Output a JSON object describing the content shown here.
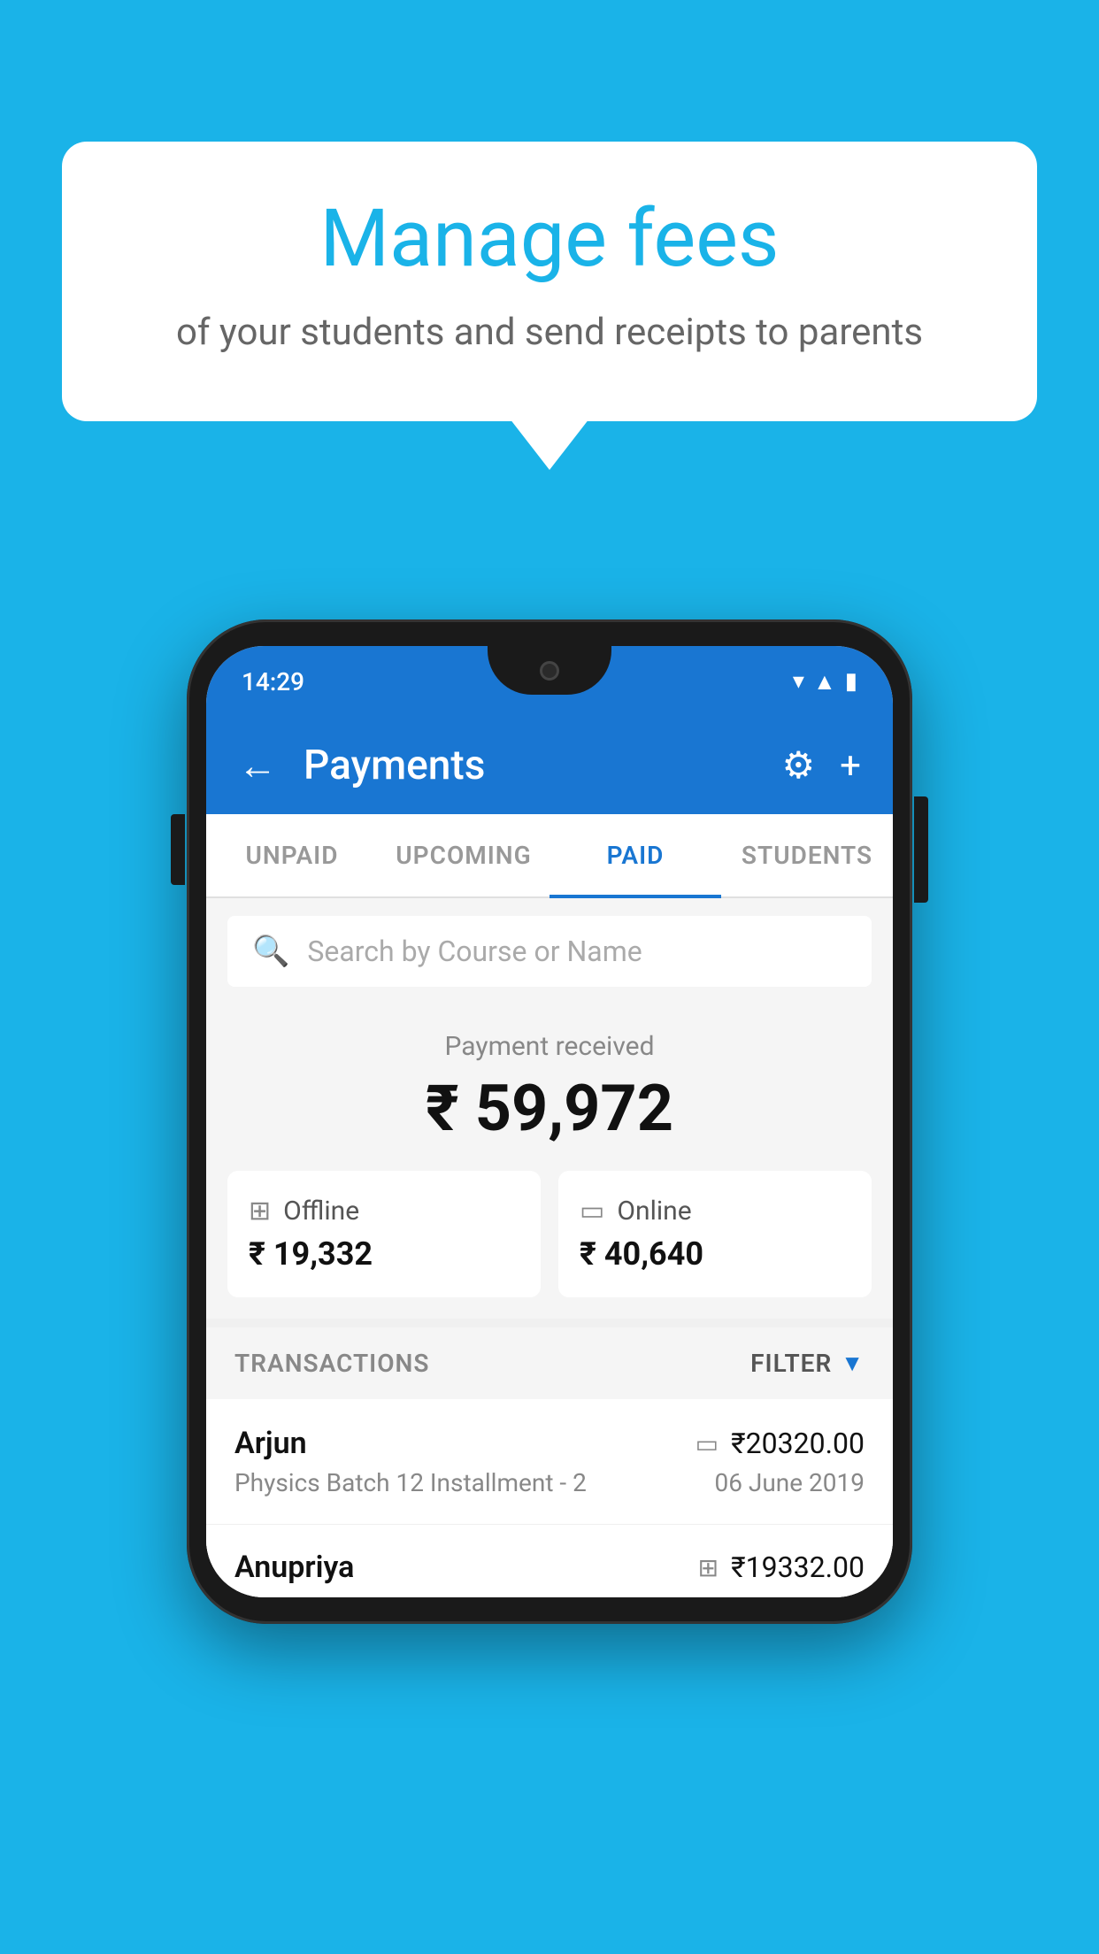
{
  "background_color": "#1ab3e8",
  "bubble": {
    "title": "Manage fees",
    "subtitle": "of your students and send receipts to parents"
  },
  "phone": {
    "status_bar": {
      "time": "14:29"
    },
    "header": {
      "title": "Payments",
      "back_label": "←",
      "settings_label": "⚙",
      "add_label": "+"
    },
    "tabs": [
      {
        "label": "UNPAID",
        "active": false
      },
      {
        "label": "UPCOMING",
        "active": false
      },
      {
        "label": "PAID",
        "active": true
      },
      {
        "label": "STUDENTS",
        "active": false
      }
    ],
    "search": {
      "placeholder": "Search by Course or Name"
    },
    "payment_summary": {
      "label": "Payment received",
      "total": "₹ 59,972",
      "offline_label": "Offline",
      "offline_amount": "₹ 19,332",
      "online_label": "Online",
      "online_amount": "₹ 40,640"
    },
    "transactions": {
      "section_label": "TRANSACTIONS",
      "filter_label": "FILTER",
      "items": [
        {
          "name": "Arjun",
          "course": "Physics Batch 12 Installment - 2",
          "amount": "₹20320.00",
          "date": "06 June 2019",
          "payment_type": "online"
        },
        {
          "name": "Anupriya",
          "amount": "₹19332.00",
          "payment_type": "offline"
        }
      ]
    }
  }
}
